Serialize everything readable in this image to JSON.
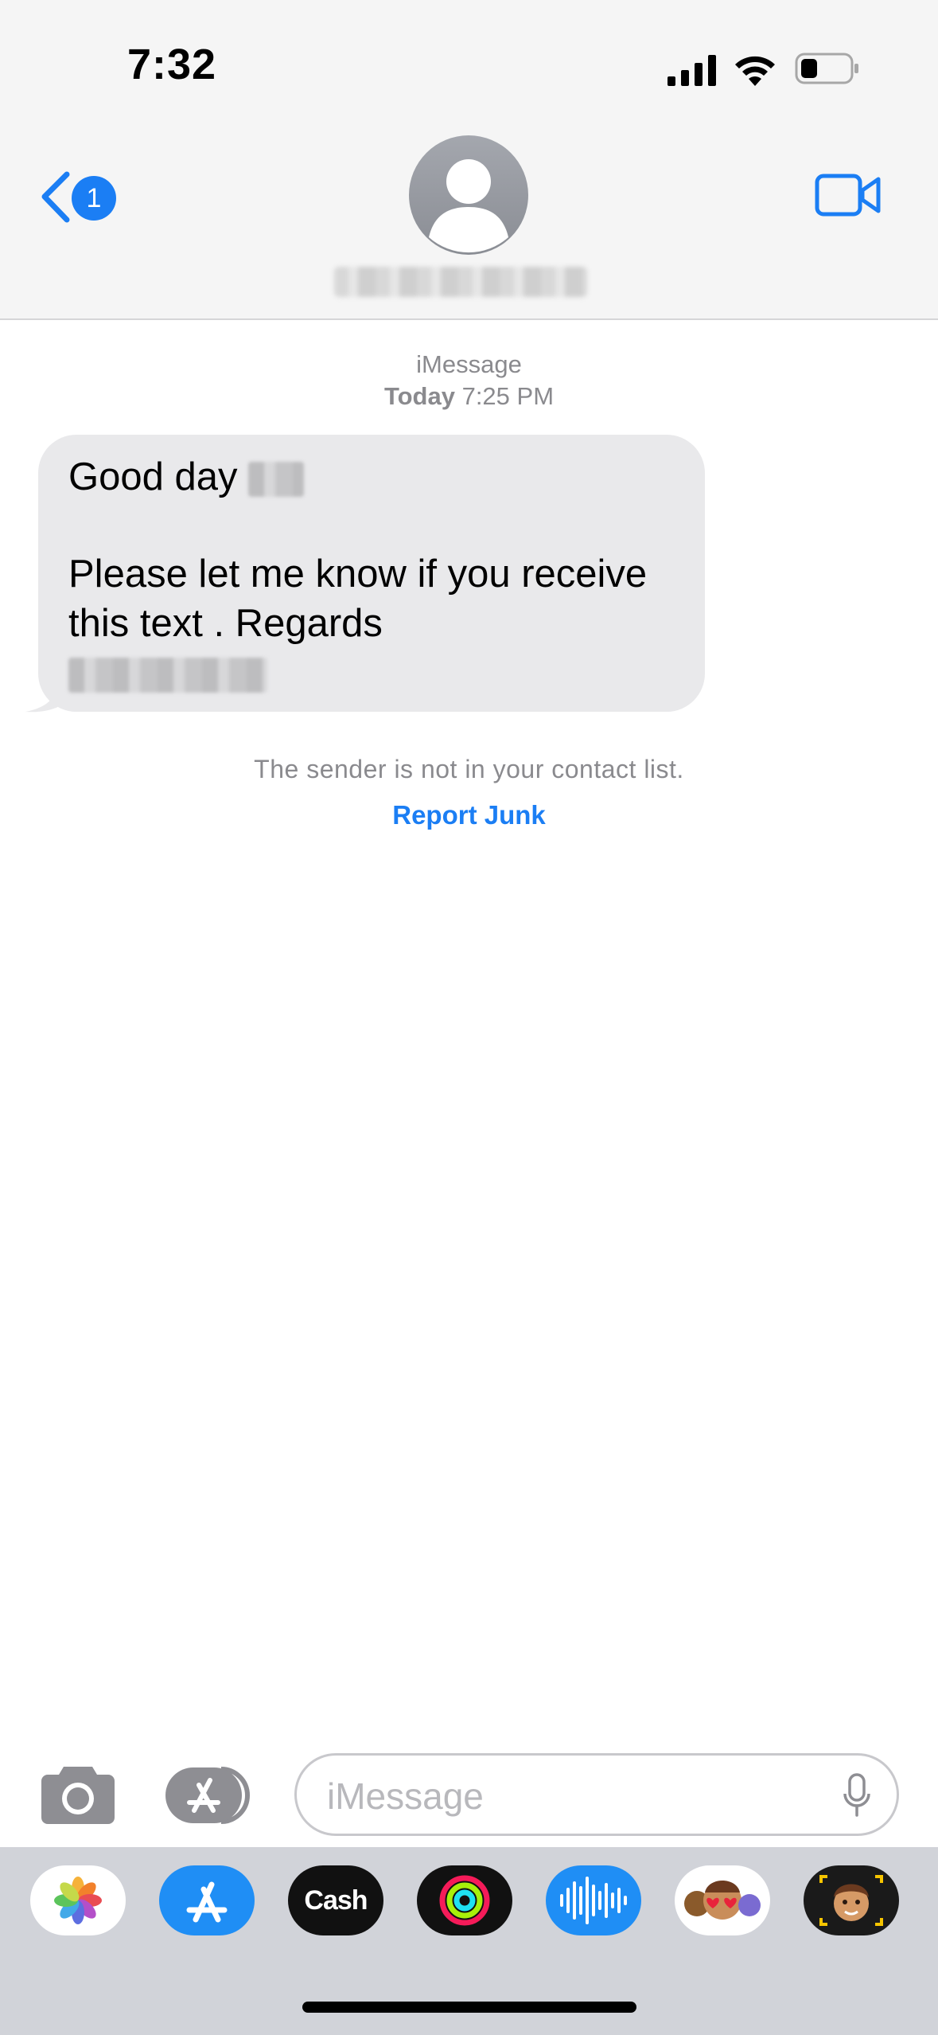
{
  "status_bar": {
    "time": "7:32"
  },
  "header": {
    "back_badge_count": "1",
    "contact_name_redacted": true
  },
  "conversation": {
    "service_label": "iMessage",
    "timestamp_day": "Today",
    "timestamp_time": "7:25 PM",
    "message": {
      "line_1": "Good day",
      "line_2": "Please let me know if you receive",
      "line_3": "this text . Regards",
      "contains_redacted_names": true
    },
    "sender_notice": "The sender is not in your contact list.",
    "report_junk_label": "Report Junk"
  },
  "input_bar": {
    "placeholder": "iMessage"
  },
  "app_drawer": {
    "apps": [
      {
        "name": "Photos",
        "icon": "photos-icon"
      },
      {
        "name": "App Store",
        "icon": "app-store-icon"
      },
      {
        "name": "Apple Cash",
        "icon": "apple-cash-icon",
        "label": "Cash"
      },
      {
        "name": "Activity",
        "icon": "activity-rings-icon"
      },
      {
        "name": "Audio Message",
        "icon": "waveform-icon"
      },
      {
        "name": "Memoji Stickers",
        "icon": "memoji-stickers-icon"
      },
      {
        "name": "Memoji",
        "icon": "memoji-icon"
      }
    ]
  },
  "colors": {
    "accent_blue": "#1b7ef4",
    "bubble_gray": "#e9e9eb",
    "secondary_text": "#8a8a8e",
    "drawer_bg": "#d1d3d9"
  }
}
